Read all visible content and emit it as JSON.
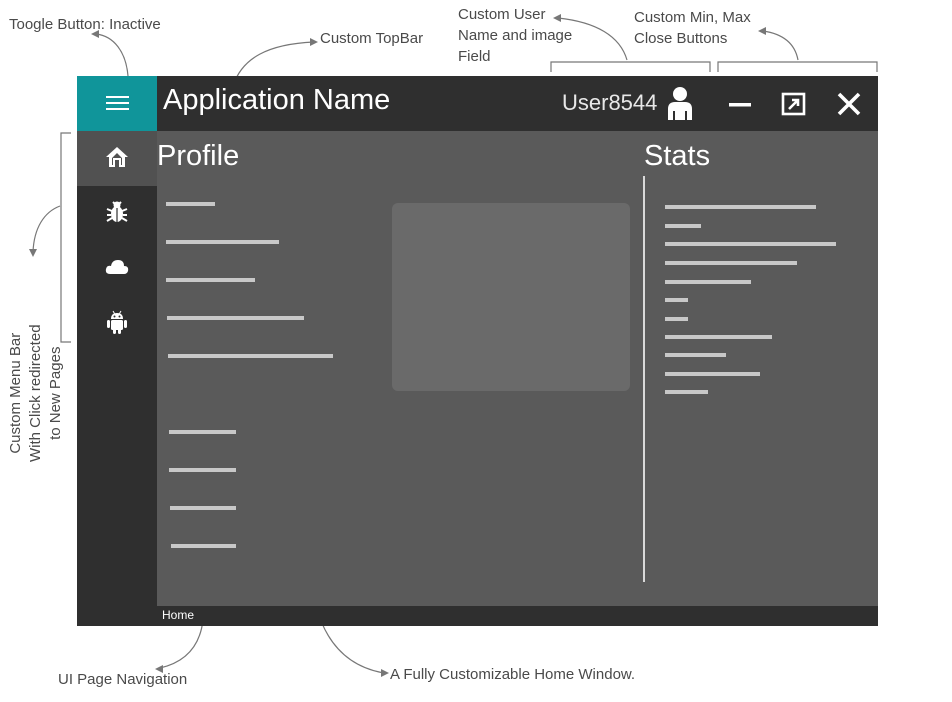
{
  "annotations": {
    "toggle": "Toogle Button: Inactive",
    "topbar": "Custom TopBar",
    "user_field": [
      "Custom User",
      "Name and image",
      "Field"
    ],
    "window_buttons": [
      "Custom Min, Max",
      "Close Buttons"
    ],
    "menu_bar": [
      "Custom Menu Bar",
      "With Click redirected",
      "to New Pages"
    ],
    "page_nav": "UI Page Navigation",
    "home_window": "A Fully Customizable Home Window."
  },
  "window": {
    "app_name": "Application Name",
    "username": "User8544",
    "accent_color": "#10959a"
  },
  "sidebar": {
    "items": [
      {
        "icon": "home-icon"
      },
      {
        "icon": "bug-icon"
      },
      {
        "icon": "cloud-icon"
      },
      {
        "icon": "android-icon"
      }
    ]
  },
  "main": {
    "profile_title": "Profile",
    "stats_title": "Stats"
  },
  "navigation": {
    "breadcrumb": "Home"
  }
}
